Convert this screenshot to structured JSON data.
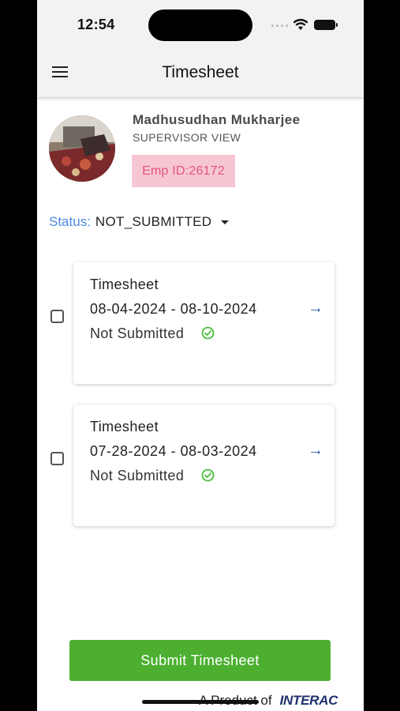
{
  "status_bar": {
    "time": "12:54"
  },
  "app_bar": {
    "title": "Timesheet",
    "menu_icon": "hamburger-menu-icon"
  },
  "profile": {
    "name": "Madhusudhan Mukharjee",
    "role": "SUPERVISOR VIEW",
    "emp_id": "Emp ID:26172"
  },
  "filter": {
    "label": "Status:",
    "value": "NOT_SUBMITTED"
  },
  "timesheets": [
    {
      "title": "Timesheet",
      "range": "08-04-2024 - 08-10-2024",
      "status": "Not Submitted",
      "arrow": "→"
    },
    {
      "title": "Timesheet",
      "range": "07-28-2024 - 08-03-2024",
      "status": "Not Submitted",
      "arrow": "→"
    }
  ],
  "submit_label": "Submit Timesheet",
  "footer": {
    "prefix": "A Product of",
    "brand": "INTERAC"
  },
  "colors": {
    "accent_green": "#4caf30",
    "emp_id_bg": "#f7c6d3",
    "emp_id_text": "#e0557a",
    "status_label": "#4a8ae0",
    "arrow": "#2f5aa0"
  }
}
